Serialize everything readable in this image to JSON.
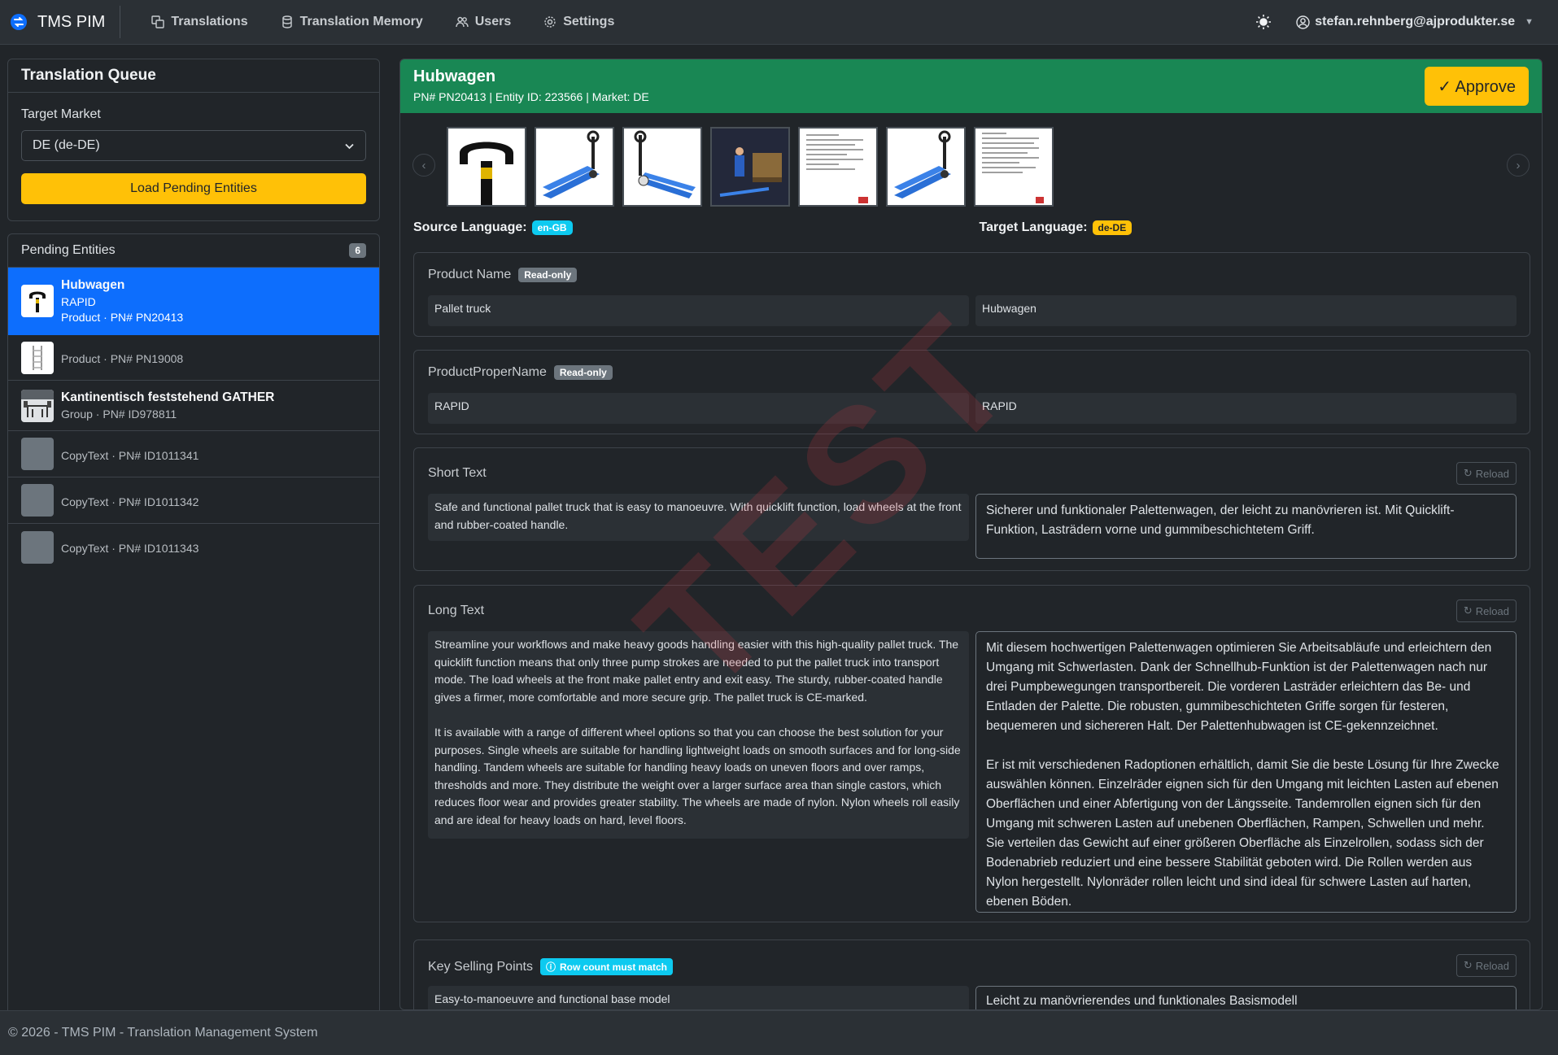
{
  "nav": {
    "brand": "TMS PIM",
    "items": [
      {
        "label": "Translations",
        "icon": "translate-icon"
      },
      {
        "label": "Translation Memory",
        "icon": "database-icon"
      },
      {
        "label": "Users",
        "icon": "users-icon"
      },
      {
        "label": "Settings",
        "icon": "gear-icon"
      }
    ],
    "user": "stefan.rehnberg@ajprodukter.se"
  },
  "queue": {
    "title": "Translation Queue",
    "target_market_label": "Target Market",
    "target_market_value": "DE (de-DE)",
    "load_button": "Load Pending Entities"
  },
  "pending": {
    "title": "Pending Entities",
    "count": "6",
    "items": [
      {
        "name": "Hubwagen",
        "line2": "RAPID",
        "line3": "Product · PN# PN20413",
        "thumb": "pallet-truck-handle"
      },
      {
        "name": "",
        "line2": "",
        "line3": "Product · PN# PN19008",
        "thumb": "shelf"
      },
      {
        "name": "Kantinentisch feststehend GATHER",
        "line2": "",
        "line3": "Group · PN# ID978811",
        "thumb": "canteen"
      },
      {
        "name": "",
        "line2": "",
        "line3": "CopyText · PN# ID1011341",
        "thumb": "gray"
      },
      {
        "name": "",
        "line2": "",
        "line3": "CopyText · PN# ID1011342",
        "thumb": "gray"
      },
      {
        "name": "",
        "line2": "",
        "line3": "CopyText · PN# ID1011343",
        "thumb": "gray"
      }
    ]
  },
  "entity": {
    "title": "Hubwagen",
    "meta": "PN# PN20413 | Entity ID: 223566 | Market: DE",
    "approve": "✓ Approve",
    "source_language_label": "Source Language:",
    "source_language": "en-GB",
    "target_language_label": "Target Language:",
    "target_language": "de-DE"
  },
  "fields": {
    "readonly_badge": "Read-only",
    "reload_label": "Reload",
    "row_count_badge": "Row count must match",
    "product_name": {
      "label": "Product Name",
      "source": "Pallet truck",
      "target": "Hubwagen"
    },
    "proper_name": {
      "label": "ProductProperName",
      "source": "RAPID",
      "target": "RAPID"
    },
    "short_text": {
      "label": "Short Text",
      "source": "Safe and functional pallet truck that is easy to manoeuvre. With quicklift function, load wheels at the front and rubber-coated handle.",
      "target": "Sicherer und funktionaler Palettenwagen, der leicht zu manövrieren ist. Mit Quicklift-Funktion, Lasträdern vorne und gummibeschichtetem Griff."
    },
    "long_text": {
      "label": "Long Text",
      "source": "Streamline your workflows and make heavy goods handling easier with this high-quality pallet truck. The quicklift function means that only three pump strokes are needed to put the pallet truck into transport mode. The load wheels at the front make pallet entry and exit easy. The sturdy, rubber-coated handle gives a firmer, more comfortable and more secure grip. The pallet truck is CE-marked.\n\nIt is available with a range of different wheel options so that you can choose the best solution for your purposes. Single wheels are suitable for handling lightweight loads on smooth surfaces and for long-side handling. Tandem wheels are suitable for handling heavy loads on uneven floors and over ramps, thresholds and more. They distribute the weight over a larger surface area than single castors, which reduces floor wear and provides greater stability. The wheels are made of nylon. Nylon wheels roll easily and are ideal for heavy loads on hard, level floors.",
      "target": "Mit diesem hochwertigen Palettenwagen optimieren Sie Arbeitsabläufe und erleichtern den Umgang mit Schwerlasten. Dank der Schnellhub-Funktion ist der Palettenwagen nach nur drei Pumpbewegungen transportbereit. Die vorderen Lasträder erleichtern das Be- und Entladen der Palette. Die robusten, gummibeschichteten Griffe sorgen für festeren, bequemeren und sichereren Halt. Der Palettenhubwagen ist CE-gekennzeichnet.\n\nEr ist mit verschiedenen Radoptionen erhältlich, damit Sie die beste Lösung für Ihre Zwecke auswählen können. Einzelräder eignen sich für den Umgang mit leichten Lasten auf ebenen Oberflächen und einer Abfertigung von der Längsseite. Tandemrollen eignen sich für den Umgang mit schweren Lasten auf unebenen Oberflächen, Rampen, Schwellen und mehr. Sie verteilen das Gewicht auf einer größeren Oberfläche als Einzelrollen, sodass sich der Bodenabrieb reduziert und eine bessere Stabilität geboten wird. Die Rollen werden aus Nylon hergestellt. Nylonräder rollen leicht und sind ideal für schwere Lasten auf harten, ebenen Böden."
    },
    "key_selling_points": {
      "label": "Key Selling Points",
      "source": "Easy-to-manoeuvre and functional base model",
      "target": "Leicht zu manövrierendes und funktionales Basismodell"
    }
  },
  "watermark": "TEST",
  "footer": "© 2026 - TMS PIM - Translation Management System",
  "colors": {
    "accent": "#0d6efd",
    "success": "#198754",
    "warning": "#ffc107",
    "info": "#0dcaf0"
  }
}
